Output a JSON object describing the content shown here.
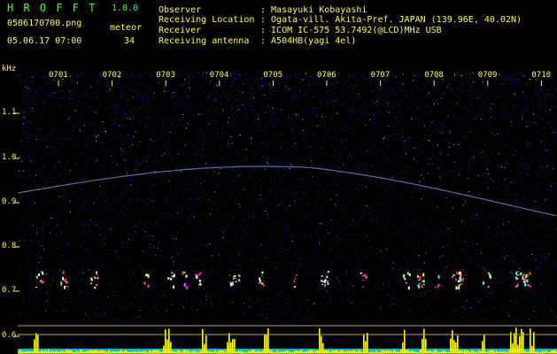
{
  "app": {
    "title": "H R O F F T",
    "version": "1.0.0",
    "filename": "0506170700.png",
    "datetime": "05.06.17 07:00",
    "meteor_label": "meteor",
    "meteor_count": "34"
  },
  "info": {
    "observer_label": "Observer",
    "observer_value": ": Masayuki Kobayashi",
    "location_label": "Receiving Location",
    "location_value": ": Ogata-vill. Akita-Pref. JAPAN (139.96E, 40.02N)",
    "receiver_label": "Receiver",
    "receiver_value": ": ICOM IC-575 53.7492(@LCD)MHz USB",
    "antenna_label": "Receiving antenna",
    "antenna_value": ": A504HB(yagi 4el)"
  },
  "axis": {
    "unit": "kHz",
    "y_ticks": [
      "1.1",
      "1.0",
      "0.9",
      "0.8",
      "0.7",
      "0.6"
    ],
    "x_ticks": [
      "0701",
      "0702",
      "0703",
      "0704",
      "0705",
      "0706",
      "0707",
      "0708",
      "0709",
      "0710"
    ]
  },
  "colors": {
    "header_green": "#4dff4d",
    "header_yellow": "#ffff4d",
    "spectrum_background": "#0a0a3a",
    "meteor_trace": "#ff4040",
    "histogram": "#ffff00",
    "noise_floor": "#00ffff"
  }
}
